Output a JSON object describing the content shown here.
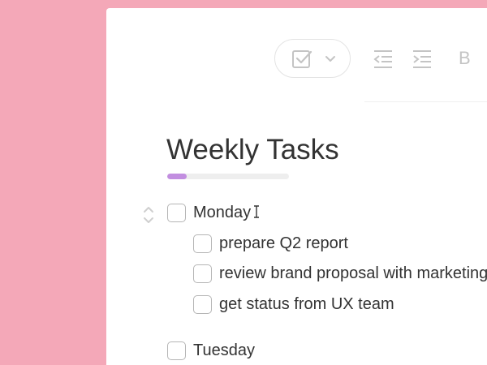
{
  "toolbar": {
    "checklist_icon": "checklist-icon",
    "dropdown_icon": "chevron-down-icon",
    "outdent_icon": "outdent-icon",
    "indent_icon": "indent-icon",
    "bold_label": "B"
  },
  "document": {
    "title": "Weekly Tasks",
    "progress": 0.16,
    "progress_color": "#c28ee0"
  },
  "tasks": [
    {
      "label": "Monday",
      "checked": false,
      "subtasks": [
        {
          "label": "prepare Q2 report",
          "checked": false
        },
        {
          "label": "review brand proposal with marketing",
          "checked": false
        },
        {
          "label": "get status from UX team",
          "checked": false
        }
      ]
    },
    {
      "label": "Tuesday",
      "checked": false,
      "subtasks": []
    }
  ],
  "colors": {
    "background": "#f4a8b8",
    "text": "#333333",
    "icon_gray": "#c4c4c4"
  }
}
